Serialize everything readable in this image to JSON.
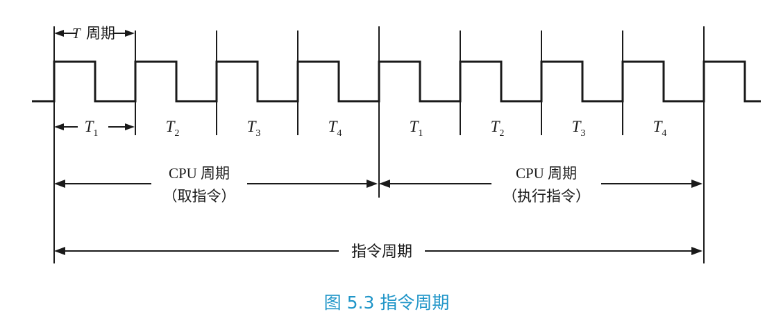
{
  "diagram": {
    "t_period_label": {
      "symbol": "T",
      "text": "周期"
    },
    "clock": {
      "cycles": 8,
      "trailing_high": true
    },
    "states": [
      {
        "symbol": "T",
        "sub": "1"
      },
      {
        "symbol": "T",
        "sub": "2"
      },
      {
        "symbol": "T",
        "sub": "3"
      },
      {
        "symbol": "T",
        "sub": "4"
      },
      {
        "symbol": "T",
        "sub": "1"
      },
      {
        "symbol": "T",
        "sub": "2"
      },
      {
        "symbol": "T",
        "sub": "3"
      },
      {
        "symbol": "T",
        "sub": "4"
      }
    ],
    "cpu_cycles": [
      {
        "line1": "CPU 周期",
        "line2": "（取指令）"
      },
      {
        "line1": "CPU 周期",
        "line2": "（执行指令）"
      }
    ],
    "instruction_cycle": "指令周期",
    "caption": "图 5.3    指令周期",
    "colors": {
      "ink": "#1a1a1a",
      "caption": "#1f95c8"
    }
  }
}
